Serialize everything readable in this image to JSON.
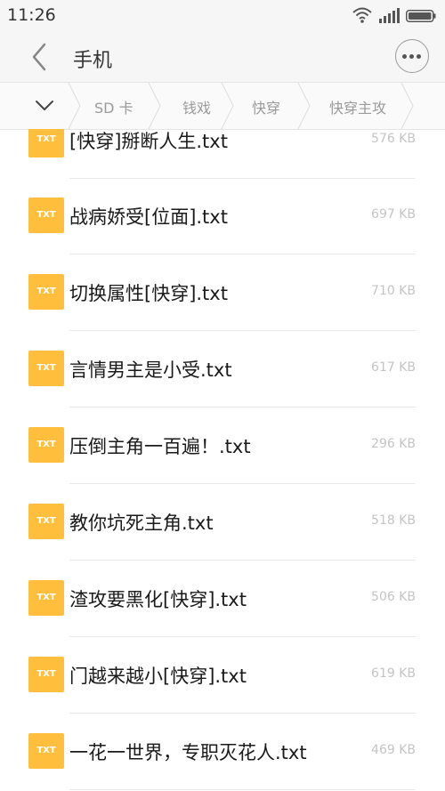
{
  "status_bar": {
    "time": "11:26"
  },
  "header": {
    "title": "手机"
  },
  "breadcrumb": [
    "SD 卡",
    "钱戏",
    "快穿",
    "快穿主攻"
  ],
  "files": [
    {
      "badge": "TXT",
      "name": "[快穿]掰断人生.txt",
      "size": "576 KB"
    },
    {
      "badge": "TXT",
      "name": "战病娇受[位面].txt",
      "size": "697 KB"
    },
    {
      "badge": "TXT",
      "name": "切换属性[快穿].txt",
      "size": "710 KB"
    },
    {
      "badge": "TXT",
      "name": "言情男主是小受.txt",
      "size": "617 KB"
    },
    {
      "badge": "TXT",
      "name": "压倒主角一百遍！.txt",
      "size": "296 KB"
    },
    {
      "badge": "TXT",
      "name": "教你坑死主角.txt",
      "size": "518 KB"
    },
    {
      "badge": "TXT",
      "name": "渣攻要黑化[快穿].txt",
      "size": "506 KB"
    },
    {
      "badge": "TXT",
      "name": "门越来越小[快穿].txt",
      "size": "619 KB"
    },
    {
      "badge": "TXT",
      "name": "一花一世界，专职灭花人.txt",
      "size": "469 KB"
    }
  ],
  "colors": {
    "file_badge": "#ffbf3d",
    "size_text": "#c4c4c4"
  }
}
